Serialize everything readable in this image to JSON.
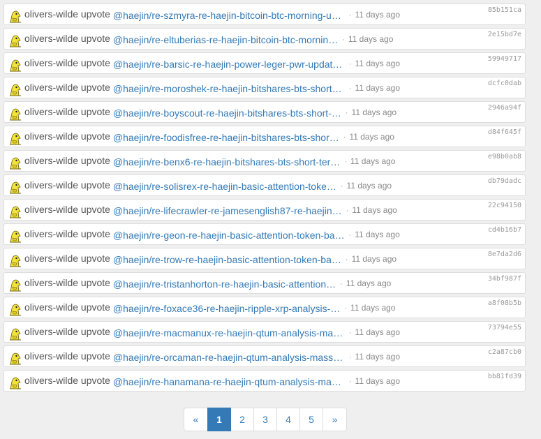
{
  "operations": [
    {
      "actor": "olivers-wilde",
      "verb": "upvote",
      "target": "@haejin/re-szmyra-re-haejin-bitcoin-btc-morning-up…",
      "time": "11 days ago",
      "txid": "85b151ca"
    },
    {
      "actor": "olivers-wilde",
      "verb": "upvote",
      "target": "@haejin/re-eltuberias-re-haejin-bitcoin-btc-mornin…",
      "time": "11 days ago",
      "txid": "2e15bd7e"
    },
    {
      "actor": "olivers-wilde",
      "verb": "upvote",
      "target": "@haejin/re-barsic-re-haejin-power-leger-pwr-update…",
      "time": "11 days ago",
      "txid": "59949717"
    },
    {
      "actor": "olivers-wilde",
      "verb": "upvote",
      "target": "@haejin/re-moroshek-re-haejin-bitshares-bts-short-…",
      "time": "11 days ago",
      "txid": "dcfc0dab"
    },
    {
      "actor": "olivers-wilde",
      "verb": "upvote",
      "target": "@haejin/re-boyscout-re-haejin-bitshares-bts-short-…",
      "time": "11 days ago",
      "txid": "2946a94f"
    },
    {
      "actor": "olivers-wilde",
      "verb": "upvote",
      "target": "@haejin/re-foodisfree-re-haejin-bitshares-bts-shor…",
      "time": "11 days ago",
      "txid": "d84f645f"
    },
    {
      "actor": "olivers-wilde",
      "verb": "upvote",
      "target": "@haejin/re-benx6-re-haejin-bitshares-bts-short-ter…",
      "time": "11 days ago",
      "txid": "e98b0ab8"
    },
    {
      "actor": "olivers-wilde",
      "verb": "upvote",
      "target": "@haejin/re-solisrex-re-haejin-basic-attention-toke…",
      "time": "11 days ago",
      "txid": "db79dadc"
    },
    {
      "actor": "olivers-wilde",
      "verb": "upvote",
      "target": "@haejin/re-lifecrawler-re-jamesenglish87-re-haejin…",
      "time": "11 days ago",
      "txid": "22c94150"
    },
    {
      "actor": "olivers-wilde",
      "verb": "upvote",
      "target": "@haejin/re-geon-re-haejin-basic-attention-token-ba…",
      "time": "11 days ago",
      "txid": "cd4b16b7"
    },
    {
      "actor": "olivers-wilde",
      "verb": "upvote",
      "target": "@haejin/re-trow-re-haejin-basic-attention-token-ba…",
      "time": "11 days ago",
      "txid": "8e7da2d6"
    },
    {
      "actor": "olivers-wilde",
      "verb": "upvote",
      "target": "@haejin/re-tristanhorton-re-haejin-basic-attention…",
      "time": "11 days ago",
      "txid": "34bf987f"
    },
    {
      "actor": "olivers-wilde",
      "verb": "upvote",
      "target": "@haejin/re-foxace36-re-haejin-ripple-xrp-analysis-…",
      "time": "11 days ago",
      "txid": "a8f08b5b"
    },
    {
      "actor": "olivers-wilde",
      "verb": "upvote",
      "target": "@haejin/re-macmanux-re-haejin-qtum-analysis-massiv…",
      "time": "11 days ago",
      "txid": "73794e55"
    },
    {
      "actor": "olivers-wilde",
      "verb": "upvote",
      "target": "@haejin/re-orcaman-re-haejin-qtum-analysis-massive…",
      "time": "11 days ago",
      "txid": "c2a87cb0"
    },
    {
      "actor": "olivers-wilde",
      "verb": "upvote",
      "target": "@haejin/re-hanamana-re-haejin-qtum-analysis-massiv…",
      "time": "11 days ago",
      "txid": "bb81fd39"
    }
  ],
  "separator": "·",
  "pagination": {
    "prev": "«",
    "pages": [
      "1",
      "2",
      "3",
      "4",
      "5"
    ],
    "active": "1",
    "next": "»"
  },
  "colors": {
    "link": "#337ab7",
    "active_page": "#337ab7",
    "background": "#efefef"
  },
  "icons": {
    "avatar": "yellow-creature-avatar-icon"
  }
}
